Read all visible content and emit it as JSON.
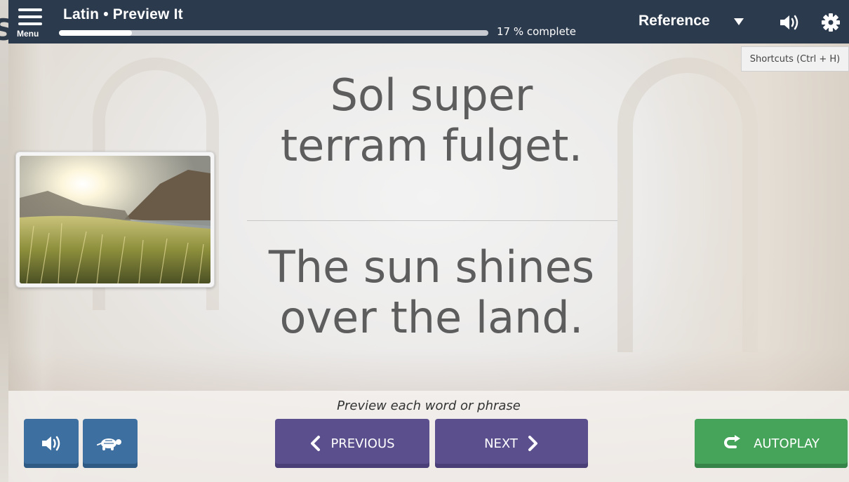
{
  "header": {
    "menu_label": "Menu",
    "title": "Latin • Preview It",
    "progress_percent": 17,
    "progress_text": "17 % complete",
    "reference_label": "Reference"
  },
  "tooltip": {
    "text": "Shortcuts (Ctrl + H)"
  },
  "card": {
    "latin_line1": "Sol super",
    "latin_line2": "terram fulget.",
    "english_line1": "The sun shines",
    "english_line2": "over the land."
  },
  "footer": {
    "hint": "Preview each word or phrase",
    "previous_label": "PREVIOUS",
    "next_label": "NEXT",
    "autoplay_label": "AUTOPLAY"
  },
  "icons": {
    "menu": "hamburger-icon",
    "dropdown": "caret-down-icon",
    "audio": "speaker-icon",
    "settings": "gear-icon",
    "slow": "turtle-icon",
    "previous": "chevron-left-icon",
    "next": "chevron-right-icon",
    "autoplay": "loop-arrow-icon"
  },
  "colors": {
    "header_bg": "#2c3a4d",
    "button_blue": "#3d6fa0",
    "button_purple": "#5b4f8e",
    "button_green": "#46a35a",
    "text_gray": "#5d5d5d"
  },
  "left_edge_glyph": "S"
}
